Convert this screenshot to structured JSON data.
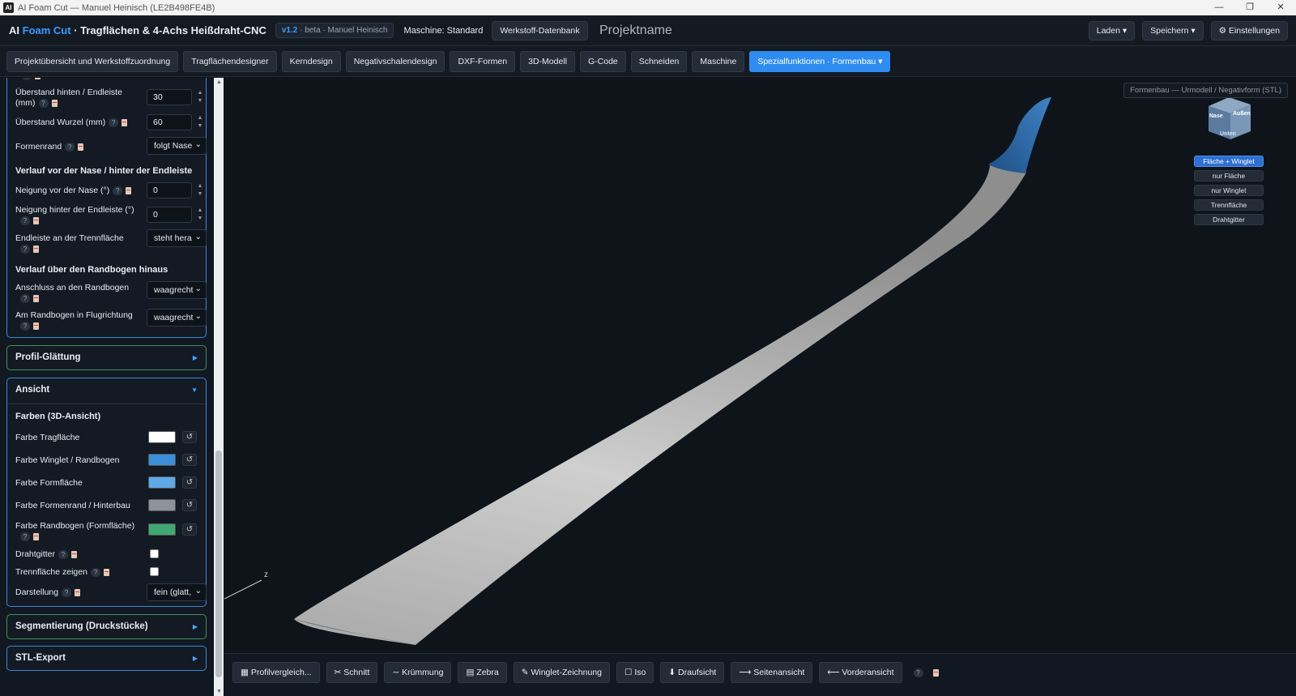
{
  "window": {
    "title": "AI Foam Cut — Manuel Heinisch (LE2B498FE4B)",
    "controls": [
      "—",
      "❐",
      "✕"
    ]
  },
  "header": {
    "brand_prefix": "AI ",
    "brand_accent": "Foam Cut",
    "brand_suffix": " · Tragflächen & 4-Achs Heißdraht-CNC",
    "version": "v1.2",
    "version_suffix": " · beta · Manuel Heinisch",
    "machine": "Maschine: Standard",
    "material_db": "Werkstoff-Datenbank",
    "project_name": "Projektname",
    "load": "Laden ▾",
    "save": "Speichern ▾",
    "settings": "⚙ Einstellungen"
  },
  "tabs": [
    {
      "label": "Projektübersicht und Werkstoffzuordnung"
    },
    {
      "label": "Tragflächendesigner"
    },
    {
      "label": "Kerndesign"
    },
    {
      "label": "Negativschalendesign"
    },
    {
      "label": "DXF-Formen"
    },
    {
      "label": "3D-Modell"
    },
    {
      "label": "G-Code"
    },
    {
      "label": "Schneiden"
    },
    {
      "label": "Maschine"
    },
    {
      "label": "Spezialfunktionen · Formenbau ▾",
      "active": true
    }
  ],
  "sidebar": {
    "overhang_rear": {
      "label": "Überstand hinten / Endleiste (mm)",
      "value": "30"
    },
    "overhang_root": {
      "label": "Überstand Wurzel (mm)",
      "value": "60"
    },
    "mold_edge": {
      "label": "Formenrand",
      "value": "folgt Nase"
    },
    "section_nose": "Verlauf vor der Nase / hinter der Endleiste",
    "slope_nose": {
      "label": "Neigung vor der Nase (°)",
      "value": "0"
    },
    "slope_trailing": {
      "label": "Neigung hinter der Endleiste (°)",
      "value": "0"
    },
    "trailing_edge": {
      "label": "Endleiste an der Trennfläche",
      "value": "steht hera"
    },
    "section_tip": "Verlauf über den Randbogen hinaus",
    "tip_connection": {
      "label": "Anschluss an den Randbogen",
      "value": "waagrecht"
    },
    "tip_flight_dir": {
      "label": "Am Randbogen in Flugrichtung",
      "value": "waagrecht"
    },
    "profile_smoothing": "Profil-Glättung",
    "view_section": "Ansicht",
    "colors_head": "Farben (3D-Ansicht)",
    "colors": [
      {
        "label": "Farbe Tragfläche",
        "color": "#ffffff"
      },
      {
        "label": "Farbe Winglet / Randbogen",
        "color": "#3a8fd8"
      },
      {
        "label": "Farbe Formfläche",
        "color": "#5ea8e8"
      },
      {
        "label": "Farbe Formenrand / Hinterbau",
        "color": "#8d939b"
      },
      {
        "label": "Farbe Randbogen (Formfläche)",
        "color": "#3fa872"
      }
    ],
    "wireframe": {
      "label": "Drahtgitter",
      "checked": false
    },
    "show_parting": {
      "label": "Trennfläche zeigen",
      "checked": false
    },
    "display": {
      "label": "Darstellung",
      "value": "fein (glatt,"
    },
    "segmentation": "Segmentierung (Druckstücke)",
    "stl_export": "STL-Export"
  },
  "viewport": {
    "label": "Formenbau — Urmodell / Negativform (STL)",
    "axis_z": "z",
    "cube": {
      "front": "Nase",
      "right": "Außen",
      "bottom": "Unten"
    },
    "view_buttons": [
      {
        "label": "Fläche + Winglet",
        "active": true
      },
      {
        "label": "nur Fläche"
      },
      {
        "label": "nur Winglet"
      },
      {
        "label": "Trennfläche"
      },
      {
        "label": "Drahtgitter"
      }
    ],
    "wing_color": "#c8c8c8",
    "winglet_color": "#2f6fb0"
  },
  "bottom": {
    "buttons": [
      "▦ Profilvergleich...",
      "✂ Schnitt",
      "∼ Krümmung",
      "▤ Zebra",
      "✎ Winglet-Zeichnung",
      "☐ Iso",
      "⬇ Draufsicht",
      "⟶ Seitenansicht",
      "⟵ Vorderansicht"
    ],
    "help": "?"
  }
}
